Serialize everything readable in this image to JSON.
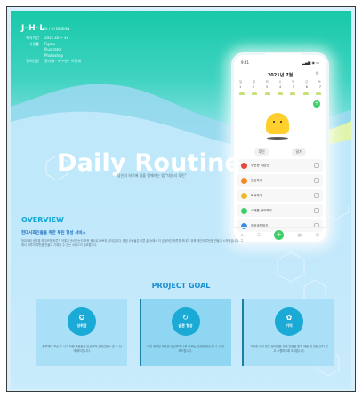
{
  "brand": {
    "logo": "J-H-L",
    "tag": "UX / UI DESIGN"
  },
  "meta": [
    {
      "key": "제작기간",
      "value": "2021.xx ~ xx"
    },
    {
      "key": "사용툴",
      "value": "Figma"
    },
    {
      "key": "",
      "value": "Illustrator"
    },
    {
      "key": "",
      "value": "Photoshop"
    },
    {
      "key": "참여인원",
      "value": "권다혜 · 최수현 · 이정재"
    }
  ],
  "hero": {
    "title": "Daily Routine",
    "subtitle": "당신의 하루에 광을 함께하는 앱 \"데일리 루틴\""
  },
  "phone": {
    "status_time": "9:41",
    "status_icons": "▂▄▆ ◉ ▭",
    "month_title": "2021년 7월",
    "days": [
      "일",
      "월",
      "화",
      "수",
      "목",
      "금",
      "토"
    ],
    "dates": [
      "1",
      "2",
      "3",
      "4",
      "5",
      "6",
      "7"
    ],
    "tabs": [
      "루틴",
      "일기"
    ],
    "items": [
      {
        "label": "루틴한 식습관",
        "color": "#e8463e"
      },
      {
        "label": "운동하기",
        "color": "#f08a2b"
      },
      {
        "label": "독서하기",
        "color": "#f0b92b"
      },
      {
        "label": "스케줄 정리하기",
        "color": "#3ecf68"
      },
      {
        "label": "영어공부하기",
        "color": "#3a8ee8"
      }
    ],
    "nav": [
      "⌂",
      "☰",
      "+",
      "▦",
      "☺"
    ]
  },
  "overview": {
    "heading": "OVERVIEW",
    "subheading": "현대사회인들을 위한 루틴 형성 서비스",
    "body": "현대사회 생활을 하다보면 하루가 어떻게 흘러가는지 모를 정도로 바쁘게 살아갑니다. 평범 사람들은 바쁜 삶 속에서 더 효율적인 하루를 보내기 위해 개인의 루틴을 만들기 시작했습니다. 그래서 하루의 루틴을 만들고 기록할 수 있는 서비스가 필요합니다."
  },
  "project_goal": {
    "heading": "PROJECT GOAL",
    "cards": [
      {
        "icon": "medal-icon",
        "glyph": "✪",
        "label": "성취감",
        "text": "한루에도 포상 수 너가 하면 목표들을 달성하며 성취감을 느낄 수 있게 해드립니다."
      },
      {
        "icon": "refresh-icon",
        "glyph": "↻",
        "label": "습관 형성",
        "text": "매일 정해진 목표를 달성하며 나를 바꾸는 습관을 형성 할 수 있게 해드립니다."
      },
      {
        "icon": "brain-icon",
        "glyph": "✿",
        "label": "기억",
        "text": "기억할 것이 많은 현대인을 위해 일정을 통해 매번 할 일을 잊지 않고 수행하도록 도와줍니다."
      }
    ]
  }
}
